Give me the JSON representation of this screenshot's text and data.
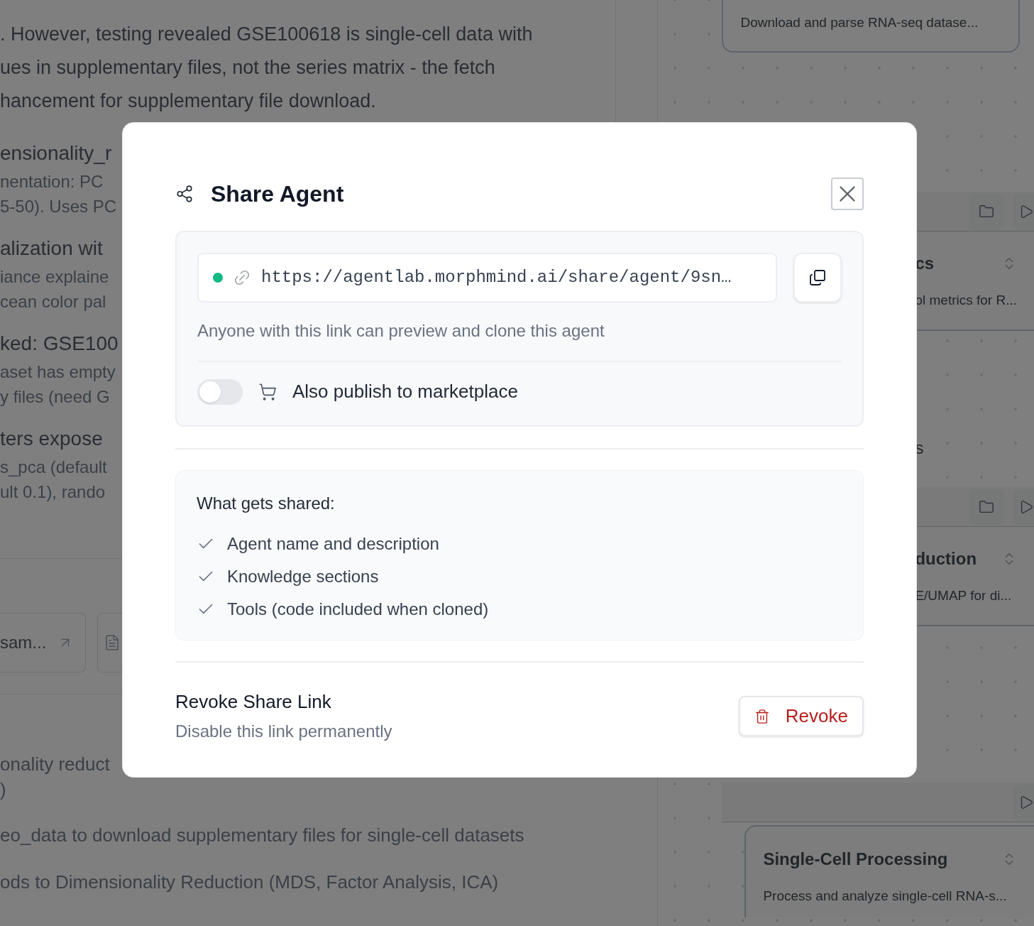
{
  "document": {
    "paragraph": [
      ". However, testing revealed GSE100618 is single-cell data with",
      "ues in supplementary files, not the series matrix - the fetch",
      "hancement for supplementary file download."
    ],
    "sections": [
      {
        "heading": "ensionality_r",
        "lines": [
          "nentation: PC",
          "5-50). Uses PC"
        ]
      },
      {
        "heading": "alization wit",
        "lines": [
          "iance explaine",
          "cean color pal"
        ]
      },
      {
        "heading": "ked: GSE100",
        "lines": [
          "aset has empty",
          "y files (need G"
        ]
      },
      {
        "heading": "ters expose",
        "lines": [
          "s_pca (default",
          "ult 0.1), rando"
        ]
      }
    ],
    "attachment": {
      "label": "sam..."
    },
    "lower_lines": [
      "onality reduct",
      ")",
      "eo_data to download supplementary files for single-cell datasets",
      "ods to Dimensionality Reduction (MDS, Factor Analysis, ICA)"
    ]
  },
  "canvas": {
    "top_card": {
      "description": "Download and parse RNA-seq datase..."
    },
    "nodes": [
      {
        "title": "cs",
        "description": "ol metrics for R...",
        "kind": "cut"
      },
      {
        "title": "s",
        "kind": "label"
      },
      {
        "title": "duction",
        "description": "E/UMAP for di...",
        "kind": "cut"
      },
      {
        "title": "Single-Cell Processing",
        "description": "Process and analyze single-cell RNA-s...",
        "kind": "full"
      }
    ]
  },
  "dialog": {
    "title": "Share Agent",
    "link": {
      "url": "https://agentlab.morphmind.ai/share/agent/9sn…",
      "active": true
    },
    "caption": "Anyone with this link can preview and clone this agent",
    "publish": {
      "label": "Also publish to marketplace",
      "on": false
    },
    "shared_heading": "What gets shared:",
    "shared_items": [
      {
        "label": "Agent name and description",
        "included": true
      },
      {
        "label": "Knowledge sections",
        "included": true
      },
      {
        "label": "Tools (code included when cloned)",
        "included": true
      }
    ],
    "revoke": {
      "title": "Revoke Share Link",
      "subtitle": "Disable this link permanently",
      "button": "Revoke"
    }
  }
}
